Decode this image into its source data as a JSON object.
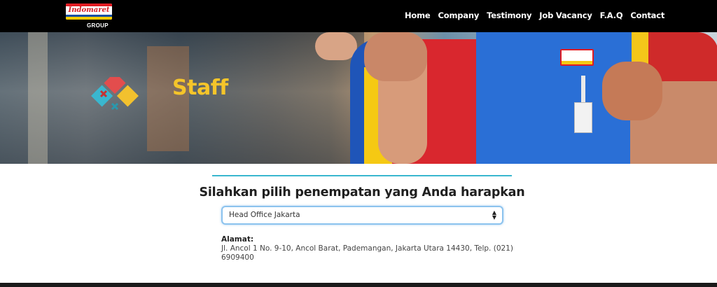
{
  "brand": {
    "logo_text": "Indomaret",
    "logo_sub": "GROUP"
  },
  "nav": {
    "items": [
      {
        "label": "Home"
      },
      {
        "label": "Company"
      },
      {
        "label": "Testimony"
      },
      {
        "label": "Job Vacancy"
      },
      {
        "label": "F.A.Q"
      },
      {
        "label": "Contact"
      }
    ]
  },
  "hero": {
    "title": "Staff",
    "title_color": "#f5c52a",
    "badge_text": "Indomaret"
  },
  "form": {
    "prompt": "Silahkan pilih penempatan yang Anda harapkan",
    "placement_select": {
      "selected": "Head Office Jakarta",
      "arrows": "⬍"
    }
  },
  "address": {
    "label": "Alamat:",
    "text": "Jl. Ancol 1 No. 9-10, Ancol Barat, Pademangan, Jakarta Utara 14430, Telp. (021) 6909400"
  },
  "colors": {
    "nav_bg": "#000000",
    "accent_line": "#3ab7cf",
    "select_border": "#8cc3ee"
  },
  "icons": {
    "hero_mark": "heart-pattern-icon",
    "select_arrows": "sort-arrows-icon"
  }
}
